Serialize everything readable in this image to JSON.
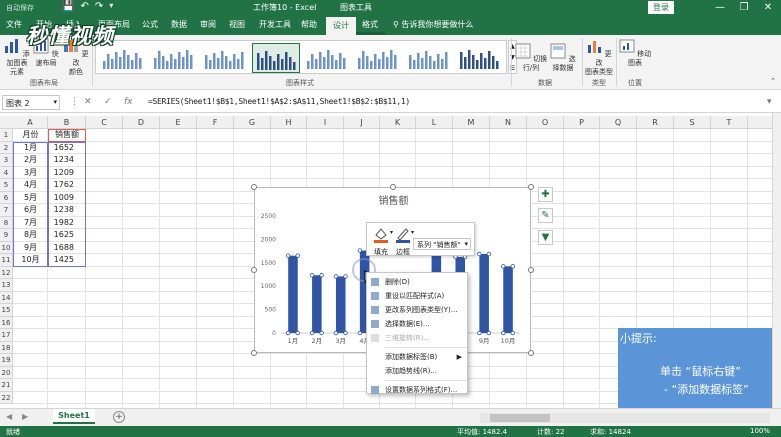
{
  "window": {
    "save_status": "自动保存",
    "title": "工作簿10 - Excel",
    "context_title": "图表工具",
    "login": "登录",
    "min": "—",
    "restore": "❐",
    "close": "✕"
  },
  "tabs": [
    "文件",
    "开始",
    "插入",
    "页面布局",
    "公式",
    "数据",
    "审阅",
    "视图",
    "开发工具",
    "帮助",
    "设计",
    "格式"
  ],
  "active_tab": "设计",
  "tell_me": "告诉我你想要做什么",
  "ribbon": {
    "add_element": "添加图表\n元素",
    "quick_layout": "快速布局",
    "change_color": "更改\n颜色",
    "layouts_group": "图表布局",
    "styles_group": "图表样式",
    "switch_row_col": "切换行/列",
    "select_data": "选择数据",
    "data_group": "数据",
    "change_type": "更改\n图表类型",
    "type_group": "类型",
    "move_chart": "移动图表",
    "location_group": "位置"
  },
  "logo_text": "秒懂视频",
  "formula_bar": {
    "name_box": "图表 2",
    "cancel": "✕",
    "enter": "✓",
    "fx": "fx",
    "formula": "=SERIES(Sheet1!$B$1,Sheet1!$A$2:$A$11,Sheet1!$B$2:$B$11,1)"
  },
  "columns": [
    "A",
    "B",
    "C",
    "D",
    "E",
    "F",
    "G",
    "H",
    "I",
    "J",
    "K",
    "L",
    "M",
    "N",
    "O",
    "P",
    "Q",
    "R",
    "S",
    "T"
  ],
  "rows": [
    "1",
    "2",
    "3",
    "4",
    "5",
    "6",
    "7",
    "8",
    "9",
    "10",
    "11",
    "12",
    "13",
    "14",
    "15",
    "16",
    "17",
    "18",
    "19",
    "20",
    "21",
    "22"
  ],
  "table": {
    "headers": [
      "月份",
      "销售额"
    ],
    "months": [
      "1月",
      "2月",
      "3月",
      "4月",
      "5月",
      "6月",
      "7月",
      "8月",
      "9月",
      "10月"
    ],
    "sales": [
      "1652",
      "1234",
      "1209",
      "1762",
      "1009",
      "1238",
      "1982",
      "1625",
      "1688",
      "1425"
    ]
  },
  "chart_data": {
    "type": "bar",
    "title": "销售额",
    "categories": [
      "1月",
      "2月",
      "3月",
      "4月",
      "5月",
      "6月",
      "7月",
      "8月",
      "9月",
      "10月"
    ],
    "values": [
      1652,
      1234,
      1209,
      1762,
      1009,
      1238,
      1982,
      1625,
      1688,
      1425
    ],
    "yticks": [
      "0",
      "500",
      "1000",
      "1500",
      "2000",
      "2500"
    ],
    "ylim": [
      0,
      2500
    ],
    "grid": false,
    "bar_color": "#2f55a4",
    "selected_series": true
  },
  "mini_toolbar": {
    "fill": "填充",
    "border": "边框",
    "series_label": "系列 \"销售额\""
  },
  "context_menu": [
    {
      "label": "删除(D)",
      "disabled": false,
      "icon": "delete-icon"
    },
    {
      "label": "重设以匹配样式(A)",
      "disabled": false,
      "icon": "reset-icon"
    },
    {
      "label": "更改系列图表类型(Y)...",
      "disabled": false,
      "icon": "chart-type-icon"
    },
    {
      "label": "选择数据(E)...",
      "disabled": false,
      "icon": "select-data-icon"
    },
    {
      "label": "三维旋转(R)...",
      "disabled": true,
      "icon": "rotate-3d-icon"
    },
    {
      "label": "添加数据标签(B)",
      "disabled": false,
      "icon": "",
      "submenu": true
    },
    {
      "label": "添加趋势线(R)...",
      "disabled": false,
      "icon": ""
    },
    {
      "label": "设置数据系列格式(F)...",
      "disabled": false,
      "icon": "format-series-icon"
    }
  ],
  "hint": {
    "title": "小提示:",
    "line1": "单击 “鼠标右键”",
    "line2": "- “添加数据标签”"
  },
  "sheet": {
    "name": "Sheet1",
    "add": "+"
  },
  "status": {
    "ready": "就绪",
    "average": "平均值: 1482.4",
    "count": "计数: 22",
    "sum": "求和: 14824",
    "zoom": "100%"
  },
  "colors": {
    "excel_green": "#217346",
    "hint_blue": "#5b95d7"
  }
}
